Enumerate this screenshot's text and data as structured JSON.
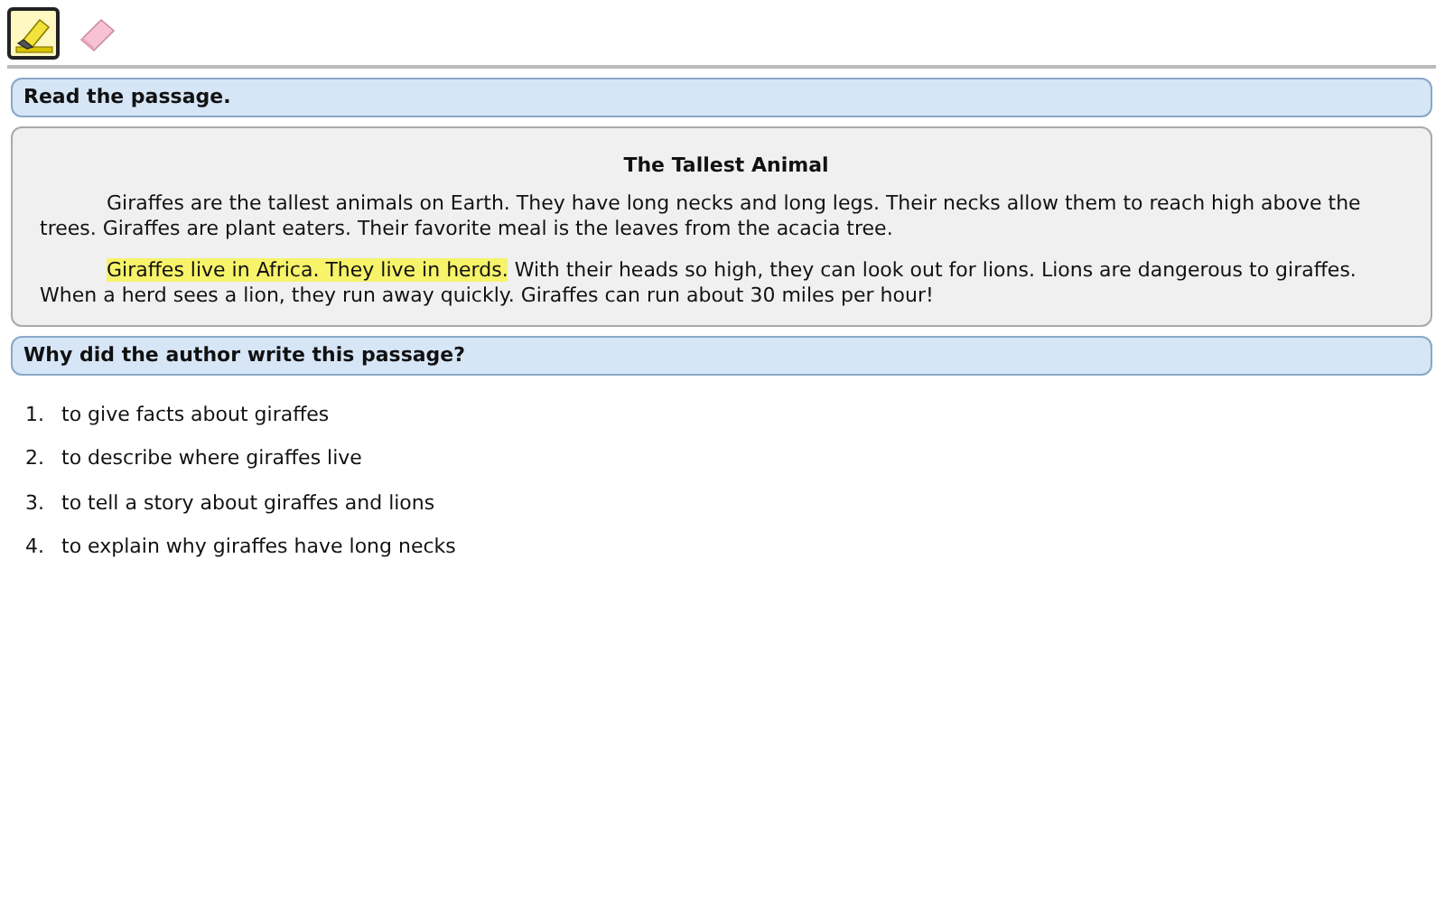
{
  "toolbar": {
    "tools": [
      {
        "kind": "highlighter",
        "selected": true
      },
      {
        "kind": "eraser",
        "selected": false
      }
    ]
  },
  "instruction": "Read the passage.",
  "passage": {
    "title": "The Tallest Animal",
    "paragraphs": [
      [
        {
          "text": "Giraffes are the tallest animals on Earth. They have long necks and long legs. Their necks allow them to reach high above the trees. Giraffes are plant eaters. Their favorite meal is the leaves from the acacia tree.",
          "highlighted": false
        }
      ],
      [
        {
          "text": "Giraffes live in Africa. They live in herds.",
          "highlighted": true
        },
        {
          "text": " With their heads so high, they can look out for lions. Lions are dangerous to giraffes. When a herd sees a lion, they run away quickly. Giraffes can run about 30 miles per hour!",
          "highlighted": false
        }
      ]
    ]
  },
  "question": "Why did the author write this passage?",
  "options": [
    {
      "number": "1.",
      "text": "to give facts about giraffes"
    },
    {
      "number": "2.",
      "text": "to describe where giraffes live"
    },
    {
      "number": "3.",
      "text": "to tell a story about giraffes and lions"
    },
    {
      "number": "4.",
      "text": "to explain why giraffes have long necks"
    }
  ]
}
